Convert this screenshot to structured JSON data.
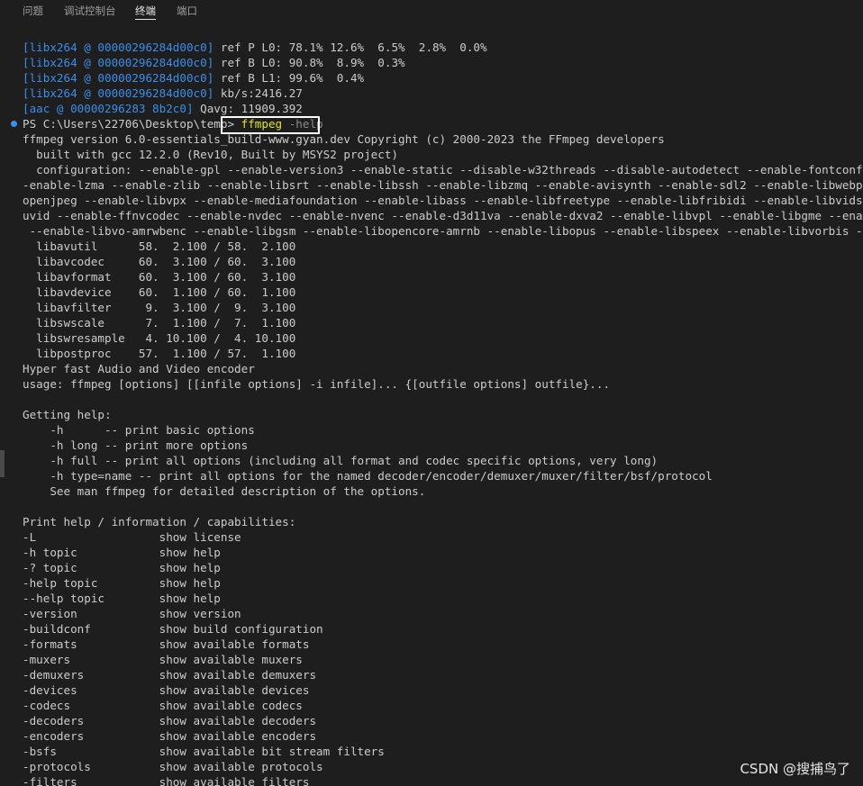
{
  "tabs": [
    {
      "label": "问题"
    },
    {
      "label": "调试控制台"
    },
    {
      "label": "终端"
    },
    {
      "label": "端口"
    }
  ],
  "terminal": {
    "log_lines": [
      {
        "prefix": "[libx264 @ 00000296284d00c0]",
        "text": " ref P L0: 78.1% 12.6%  6.5%  2.8%  0.0%"
      },
      {
        "prefix": "[libx264 @ 00000296284d00c0]",
        "text": " ref B L0: 90.8%  8.9%  0.3%"
      },
      {
        "prefix": "[libx264 @ 00000296284d00c0]",
        "text": " ref B L1: 99.6%  0.4%"
      },
      {
        "prefix": "[libx264 @ 00000296284d00c0]",
        "text": " kb/s:2416.27"
      },
      {
        "prefix": "[aac @ 00000296283 8b2c0]",
        "text": " Qavg: 11909.392"
      }
    ],
    "prompt": {
      "ps": "PS C:\\Users\\22706\\Desktop\\temp> ",
      "command": "ffmpeg",
      "args": " -help"
    },
    "output_lines": [
      "ffmpeg version 6.0-essentials_build-www.gyan.dev Copyright (c) 2000-2023 the FFmpeg developers",
      "  built with gcc 12.2.0 (Rev10, Built by MSYS2 project)",
      "  configuration: --enable-gpl --enable-version3 --enable-static --disable-w32threads --disable-autodetect --enable-fontconfig --enable",
      "-enable-lzma --enable-zlib --enable-libsrt --enable-libssh --enable-libzmq --enable-avisynth --enable-sdl2 --enable-libwebp --enable-l",
      "openjpeg --enable-libvpx --enable-mediafoundation --enable-libass --enable-libfreetype --enable-libfribidi --enable-libvidstab --enabl",
      "uvid --enable-ffnvcodec --enable-nvdec --enable-nvenc --enable-d3d11va --enable-dxva2 --enable-libvpl --enable-libgme --enable-libope",
      " --enable-libvo-amrwbenc --enable-libgsm --enable-libopencore-amrnb --enable-libopus --enable-libspeex --enable-libvorbis --enable-li",
      "  libavutil      58.  2.100 / 58.  2.100",
      "  libavcodec     60.  3.100 / 60.  3.100",
      "  libavformat    60.  3.100 / 60.  3.100",
      "  libavdevice    60.  1.100 / 60.  1.100",
      "  libavfilter     9.  3.100 /  9.  3.100",
      "  libswscale      7.  1.100 /  7.  1.100",
      "  libswresample   4. 10.100 /  4. 10.100",
      "  libpostproc    57.  1.100 / 57.  1.100",
      "Hyper fast Audio and Video encoder",
      "usage: ffmpeg [options] [[infile options] -i infile]... {[outfile options] outfile}...",
      "",
      "Getting help:",
      "    -h      -- print basic options",
      "    -h long -- print more options",
      "    -h full -- print all options (including all format and codec specific options, very long)",
      "    -h type=name -- print all options for the named decoder/encoder/demuxer/muxer/filter/bsf/protocol",
      "    See man ffmpeg for detailed description of the options.",
      "",
      "Print help / information / capabilities:",
      "-L                  show license",
      "-h topic            show help",
      "-? topic            show help",
      "-help topic         show help",
      "--help topic        show help",
      "-version            show version",
      "-buildconf          show build configuration",
      "-formats            show available formats",
      "-muxers             show available muxers",
      "-demuxers           show available demuxers",
      "-devices            show available devices",
      "-codecs             show available codecs",
      "-decoders           show available decoders",
      "-encoders           show available encoders",
      "-bsfs               show available bit stream filters",
      "-protocols          show available protocols",
      "-filters            show available filters"
    ]
  },
  "watermark": "CSDN @搜捕鸟了",
  "colors": {
    "background": "#1e1e1e",
    "text": "#cccccc",
    "log_prefix": "#3b8eea",
    "command": "#e5e510",
    "highlight_box": "#ffffff"
  }
}
